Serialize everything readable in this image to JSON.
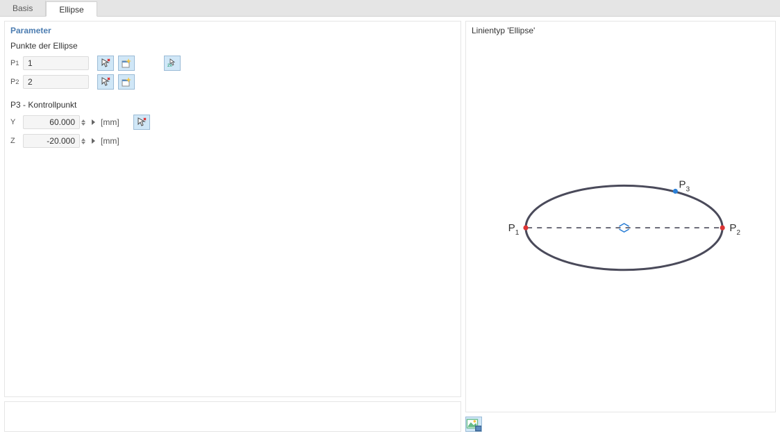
{
  "tabs": {
    "basis": "Basis",
    "ellipse": "Ellipse",
    "active": "ellipse"
  },
  "param_panel": {
    "title": "Parameter",
    "points_header": "Punkte der Ellipse",
    "p1_label": "P",
    "p1_sub": "1",
    "p1_value": "1",
    "p2_label": "P",
    "p2_sub": "2",
    "p2_value": "2",
    "control_header": "P3 - Kontrollpunkt",
    "y_label": "Y",
    "y_value": "60.000",
    "y_unit": "[mm]",
    "z_label": "Z",
    "z_value": "-20.000",
    "z_unit": "[mm]"
  },
  "preview": {
    "title": "Linientyp 'Ellipse'",
    "p1_label": "P",
    "p1_sub": "1",
    "p2_label": "P",
    "p2_sub": "2",
    "p3_label": "P",
    "p3_sub": "3"
  }
}
